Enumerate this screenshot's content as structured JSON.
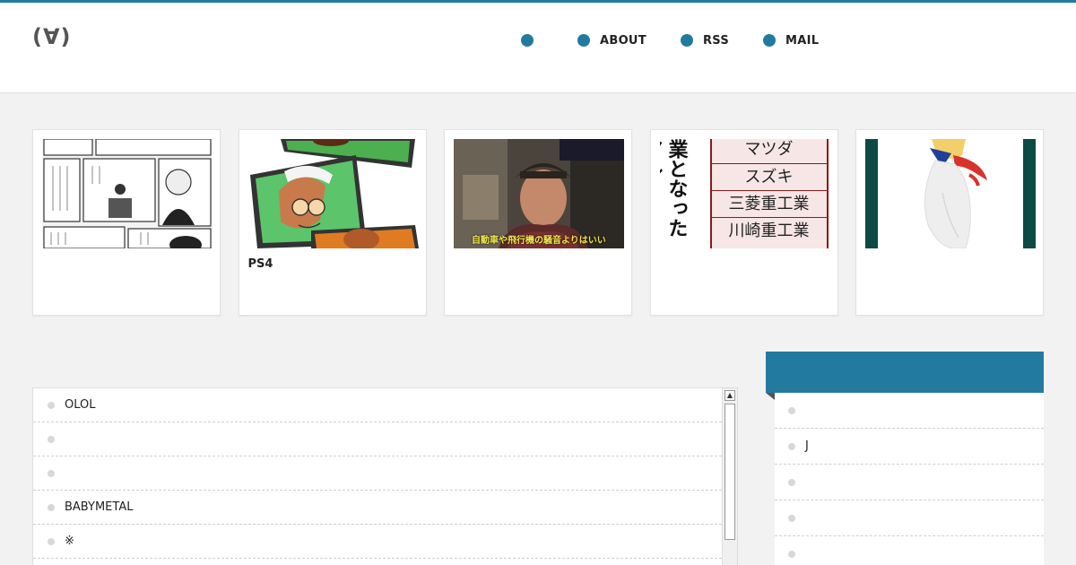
{
  "site": {
    "logo": "(∀)"
  },
  "nav": [
    {
      "label": ""
    },
    {
      "label": "ABOUT"
    },
    {
      "label": "RSS"
    },
    {
      "label": "MAIL"
    }
  ],
  "cards": [
    {
      "title": ""
    },
    {
      "title": "PS4"
    },
    {
      "title": "",
      "caption": "自動車や飛行機の騒音よりはいい"
    },
    {
      "title": "",
      "words": [
        "マツダ",
        "スズキ",
        "三菱重工業",
        "川崎重工業"
      ],
      "side_text": "業となったアル"
    },
    {
      "title": ""
    }
  ],
  "list": [
    {
      "label": "OLOL"
    },
    {
      "label": ""
    },
    {
      "label": ""
    },
    {
      "label": "BABYMETAL"
    },
    {
      "label": "※"
    },
    {
      "label": ""
    }
  ],
  "sidebar": {
    "title": "",
    "items": [
      {
        "label": ""
      },
      {
        "label": "J"
      },
      {
        "label": ""
      },
      {
        "label": ""
      },
      {
        "label": ""
      }
    ]
  },
  "colors": {
    "accent": "#237aa0",
    "background": "#f2f2f2"
  }
}
